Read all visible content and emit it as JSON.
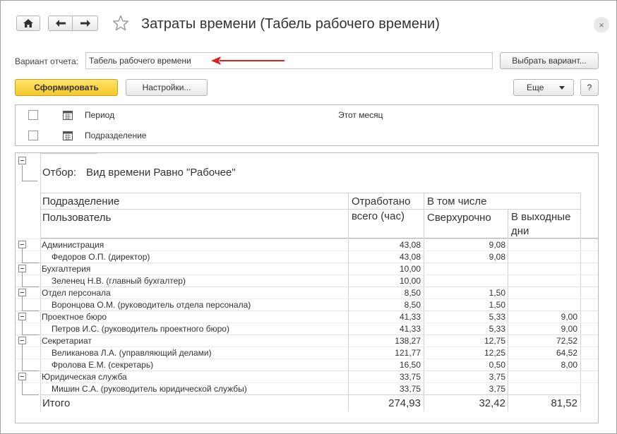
{
  "window": {
    "title": "Затраты времени (Табель рабочего времени)",
    "close_glyph": "×"
  },
  "variant": {
    "label": "Вариант отчета:",
    "value": "Табель рабочего времени",
    "choose_button": "Выбрать вариант..."
  },
  "toolbar": {
    "generate_button": "Сформировать",
    "settings_button": "Настройки...",
    "more_button": "Еще",
    "help_button": "?"
  },
  "settings": [
    {
      "name": "Период",
      "value": "Этот месяц",
      "checked": false
    },
    {
      "name": "Подразделение",
      "value": "",
      "checked": false
    }
  ],
  "report": {
    "filter_label": "Отбор:",
    "filter_value": "Вид времени Равно \"Рабочее\"",
    "headers": {
      "department": "Подразделение",
      "user": "Пользователь",
      "worked_total_1": "Отработано",
      "worked_total_2": "всего (час)",
      "including": "В том числе",
      "overtime": "Сверхурочно",
      "weekends_1": "В выходные",
      "weekends_2": "дни"
    },
    "rows": [
      {
        "name": "Администрация",
        "level": 0,
        "total": "43,08",
        "overtime": "9,08",
        "weekend": ""
      },
      {
        "name": "Федоров О.П. (директор)",
        "level": 1,
        "total": "43,08",
        "overtime": "9,08",
        "weekend": ""
      },
      {
        "name": "Бухгалтерия",
        "level": 0,
        "total": "10,00",
        "overtime": "",
        "weekend": ""
      },
      {
        "name": "Зеленец Н.В. (главный бухгалтер)",
        "level": 1,
        "total": "10,00",
        "overtime": "",
        "weekend": ""
      },
      {
        "name": "Отдел персонала",
        "level": 0,
        "total": "8,50",
        "overtime": "1,50",
        "weekend": ""
      },
      {
        "name": "Воронцова О.М. (руководитель отдела персонала)",
        "level": 1,
        "total": "8,50",
        "overtime": "1,50",
        "weekend": ""
      },
      {
        "name": "Проектное бюро",
        "level": 0,
        "total": "41,33",
        "overtime": "5,33",
        "weekend": "9,00"
      },
      {
        "name": "Петров И.С. (руководитель проектного бюро)",
        "level": 1,
        "total": "41,33",
        "overtime": "5,33",
        "weekend": "9,00"
      },
      {
        "name": "Секретариат",
        "level": 0,
        "total": "138,27",
        "overtime": "12,75",
        "weekend": "72,52"
      },
      {
        "name": "Великанова Л.А. (управляющий делами)",
        "level": 1,
        "total": "121,77",
        "overtime": "12,25",
        "weekend": "64,52"
      },
      {
        "name": "Фролова Е.М. (секретарь)",
        "level": 1,
        "total": "16,50",
        "overtime": "0,50",
        "weekend": "8,00"
      },
      {
        "name": "Юридическая служба",
        "level": 0,
        "total": "33,75",
        "overtime": "3,75",
        "weekend": ""
      },
      {
        "name": "Мишин С.А. (руководитель юридической службы)",
        "level": 1,
        "total": "33,75",
        "overtime": "3,75",
        "weekend": ""
      }
    ],
    "total": {
      "label": "Итого",
      "total": "274,93",
      "overtime": "32,42",
      "weekend": "81,52"
    }
  },
  "colors": {
    "accent_yellow": "#f5c928",
    "arrow_red": "#e0201e"
  }
}
